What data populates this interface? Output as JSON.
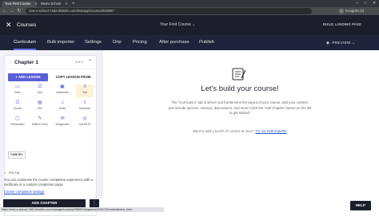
{
  "browser": {
    "tabs": [
      {
        "title": "Your First Course"
      },
      {
        "title": "New's School"
      }
    ],
    "url": "new-s-school-7482.thinkific.com/manage/courses/938997",
    "profile_label": "Incognito (2)"
  },
  "header": {
    "title": "Courses",
    "course_selector": "Your First Course",
    "build_landing_label": "BUILD LANDING PAGE"
  },
  "subnav": {
    "tabs": [
      "Curriculum",
      "Bulk importer",
      "Settings",
      "Drip",
      "Pricing",
      "After purchase",
      "Publish"
    ],
    "preview_label": "PREVIEW"
  },
  "sidebar": {
    "chapter_title": "Chapter 1",
    "chapter_count": "0 of 0",
    "add_lesson_label": "+ ADD LESSON",
    "copy_lesson_label": "COPY LESSON FROM",
    "lesson_types": [
      {
        "label": "Video",
        "icon": "video-icon"
      },
      {
        "label": "Quiz",
        "icon": "quiz-icon"
      },
      {
        "label": "Multimedia",
        "icon": "multimedia-icon"
      },
      {
        "label": "Text",
        "icon": "text-icon"
      },
      {
        "label": "Survey",
        "icon": "survey-icon"
      },
      {
        "label": "PDF",
        "icon": "pdf-icon"
      },
      {
        "label": "Audio",
        "icon": "audio-icon"
      },
      {
        "label": "Download",
        "icon": "download-icon"
      },
      {
        "label": "Presentation",
        "icon": "presentation-icon"
      },
      {
        "label": "Brillium Exam",
        "icon": "exam-icon"
      },
      {
        "label": "Assignment",
        "icon": "assignment-icon"
      },
      {
        "label": "Live BETA",
        "icon": "live-icon"
      }
    ],
    "cancel_label": "CANCEL",
    "protip_title": "Pro Tip",
    "protip_text": "You can customize the course completion experience with a certificate or a custom completion page!",
    "settings_link": "Course completion settings",
    "add_chapter_label": "ADD CHAPTER"
  },
  "main": {
    "title": "Let's build your course!",
    "description": "The \"Curriculum\" tab is where you'll determine the layout of your course, add your content, and include quizzes, surveys, discussions, and more! Click the 'Add Chapter' button on the left to get started.",
    "bulk_prompt": "Want to add a bunch of content at once?",
    "bulk_link": "Try our bulk importer"
  },
  "status_url": "https://new-s-school-7482.thinkific.com/manage/courses/938997/chapters/4201172/contents/new_html",
  "help_label": "HELP",
  "colors": {
    "accent": "#5a5fd6",
    "header": "#1b1e2b",
    "subnav": "#20243a"
  }
}
